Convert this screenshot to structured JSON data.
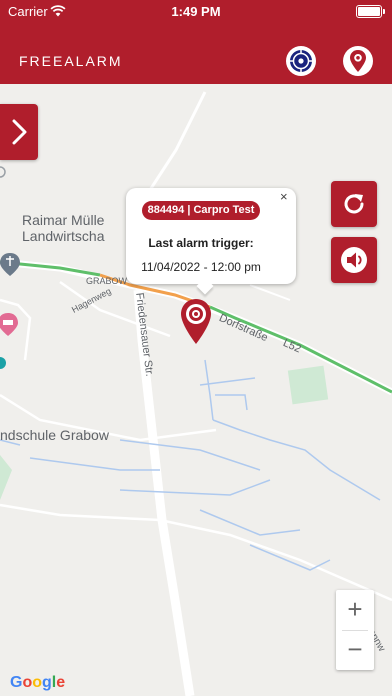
{
  "status_bar": {
    "carrier": "Carrier",
    "time": "1:49 PM"
  },
  "header": {
    "title": "FREEALARM",
    "accent_color": "#b01e2c",
    "gps_icon": "crosshair-target-icon",
    "location_icon": "location-pin-icon"
  },
  "map": {
    "labels": {
      "raimar_line1": "Raimar Mülle",
      "raimar_line2": "Landwirtscha",
      "grabow": "GRABOW",
      "hagenweg": "Hagenweg",
      "dorfstrasse": "Dorfstraße",
      "l52": "L52",
      "friedensauer": "Friedensauer Str.",
      "schule": "ndschule Grabow",
      "fennweg": "Fennw"
    },
    "popup": {
      "badge": "884494 | Carpro Test",
      "close": "×",
      "trigger_label": "Last alarm trigger:",
      "trigger_date": "11/04/2022 - 12:00 pm"
    },
    "zoom_in": "+",
    "zoom_out": "−",
    "google_letters": [
      "G",
      "o",
      "o",
      "g",
      "l",
      "e"
    ],
    "google_colors": [
      "#4285F4",
      "#EA4335",
      "#FBBC05",
      "#4285F4",
      "#34A853",
      "#EA4335"
    ]
  }
}
